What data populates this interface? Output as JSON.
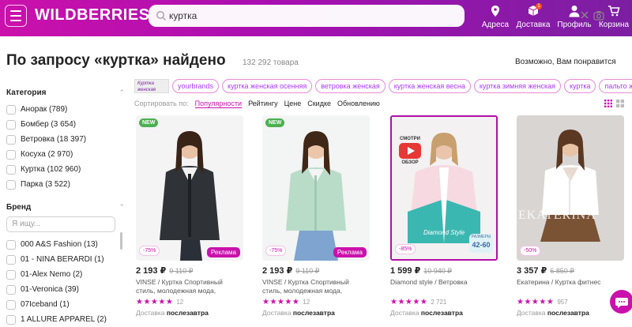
{
  "header": {
    "logo": "WILDBERRIES",
    "search_value": "куртка",
    "nav": [
      "Адреса",
      "Доставка",
      "Профиль",
      "Корзина"
    ],
    "cart_badge": "1",
    "colors": {
      "gradient_start": "#cb11ab",
      "gradient_end": "#7b1fa2"
    }
  },
  "page": {
    "title": "По запросу «куртка» найдено",
    "count": "132 292 товара",
    "suggest": "Возможно, Вам понравится"
  },
  "filters": {
    "category_title": "Категория",
    "categories": [
      "Анорак (789)",
      "Бомбер (3 654)",
      "Ветровка (18 397)",
      "Косуха (2 970)",
      "Куртка (102 960)",
      "Парка (3 522)"
    ],
    "brand_title": "Бренд",
    "brand_placeholder": "Я ищу...",
    "brands": [
      "000 A&S Fashion (13)",
      "01 - NINA BERARDI (1)",
      "01-Alex Nemo (2)",
      "01-Veronica (39)",
      "07Iceband (1)",
      "1 ALLURE APPAREL (2)"
    ]
  },
  "chips": {
    "image_chip": "Куртка женская",
    "items": [
      "yourbrands",
      "куртка женская осенняя",
      "ветровка женская",
      "куртка женская весна",
      "куртка зимняя женская",
      "куртка",
      "пальто женское"
    ]
  },
  "sort": {
    "label": "Сортировать по:",
    "options": [
      "Популярности",
      "Рейтингу",
      "Цене",
      "Скидке",
      "Обновлению"
    ]
  },
  "products": [
    {
      "new": "NEW",
      "discount": "-75%",
      "ad": "Реклама",
      "price": "2 193 ₽",
      "old_price": "9 110 ₽",
      "desc": "VINSE / Куртка Спортивный стиль, молодежная мода, подростковый",
      "stars": "★★★★★",
      "reviews": "12",
      "delivery_label": "Доставка",
      "delivery_day": "послезавтра"
    },
    {
      "new": "NEW",
      "discount": "-75%",
      "ad": "Реклама",
      "price": "2 193 ₽",
      "old_price": "9 110 ₽",
      "desc": "VINSE / Куртка Спортивный стиль, молодежная мода, подростковый",
      "stars": "★★★★★",
      "reviews": "12",
      "delivery_label": "Доставка",
      "delivery_day": "послезавтра"
    },
    {
      "video_top": "СМОТРИ",
      "video_bottom": "ОБЗОР",
      "watermark": "Diamond Style",
      "sizes_label": "РАЗМЕРЫ",
      "sizes": "42-60",
      "discount": "-85%",
      "price": "1 599 ₽",
      "old_price": "10 940 ₽",
      "desc": "Diamond style / Ветровка",
      "stars": "★★★★★",
      "reviews": "2 721",
      "delivery_label": "Доставка",
      "delivery_day": "послезавтра"
    },
    {
      "brand_watermark": "EKATERINA",
      "discount": "-50%",
      "price": "3 357 ₽",
      "old_price": "6 850 ₽",
      "desc": "Екатерина / Куртка фитнес",
      "stars": "★★★★★",
      "reviews": "957",
      "delivery_label": "Доставка",
      "delivery_day": "послезавтра"
    }
  ]
}
